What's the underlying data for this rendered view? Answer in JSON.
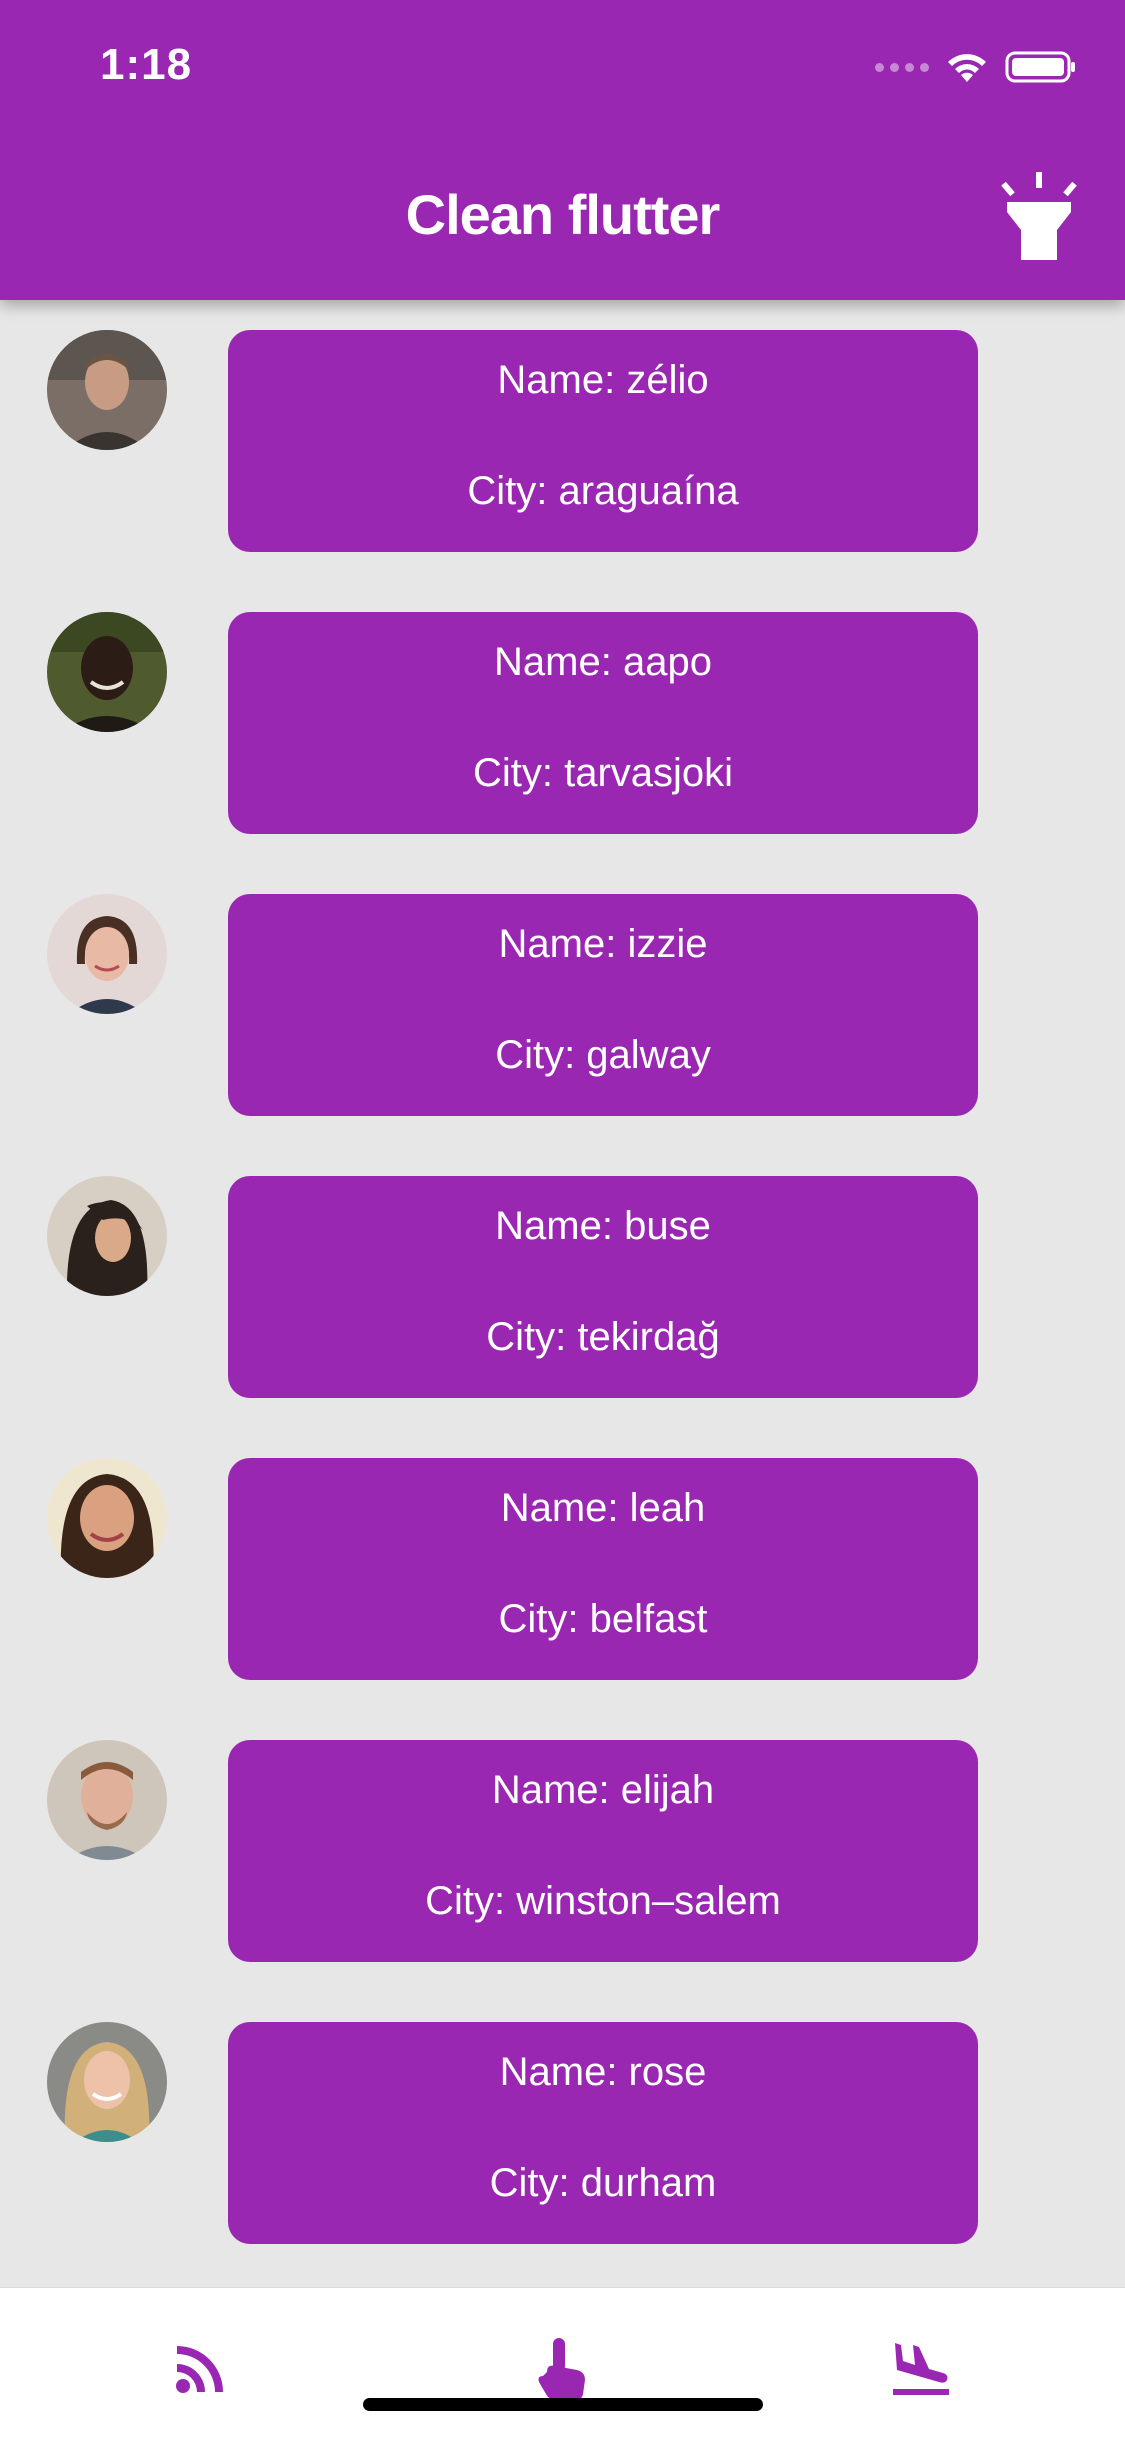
{
  "status_bar": {
    "time": "1:18",
    "icons": [
      "cellular-signal-icon",
      "wifi-icon",
      "battery-icon"
    ]
  },
  "app_bar": {
    "title": "Clean flutter",
    "action_icon": "flashlight-icon"
  },
  "theme": {
    "primary": "#9a27b1",
    "background": "#e8e7e8",
    "card_text": "#ffffff"
  },
  "contacts": [
    {
      "name_label": "Name: zélio",
      "city_label": "City: araguaína"
    },
    {
      "name_label": "Name: aapo",
      "city_label": "City: tarvasjoki"
    },
    {
      "name_label": "Name: izzie",
      "city_label": "City: galway"
    },
    {
      "name_label": "Name: buse",
      "city_label": "City: tekirdağ"
    },
    {
      "name_label": "Name: leah",
      "city_label": "City: belfast"
    },
    {
      "name_label": "Name: elijah",
      "city_label": "City: winston–salem"
    },
    {
      "name_label": "Name: rose",
      "city_label": "City: durham"
    }
  ],
  "bottom_nav": {
    "items": [
      {
        "icon": "rss-feed-icon"
      },
      {
        "icon": "touch-app-icon"
      },
      {
        "icon": "flight-land-icon"
      }
    ]
  }
}
